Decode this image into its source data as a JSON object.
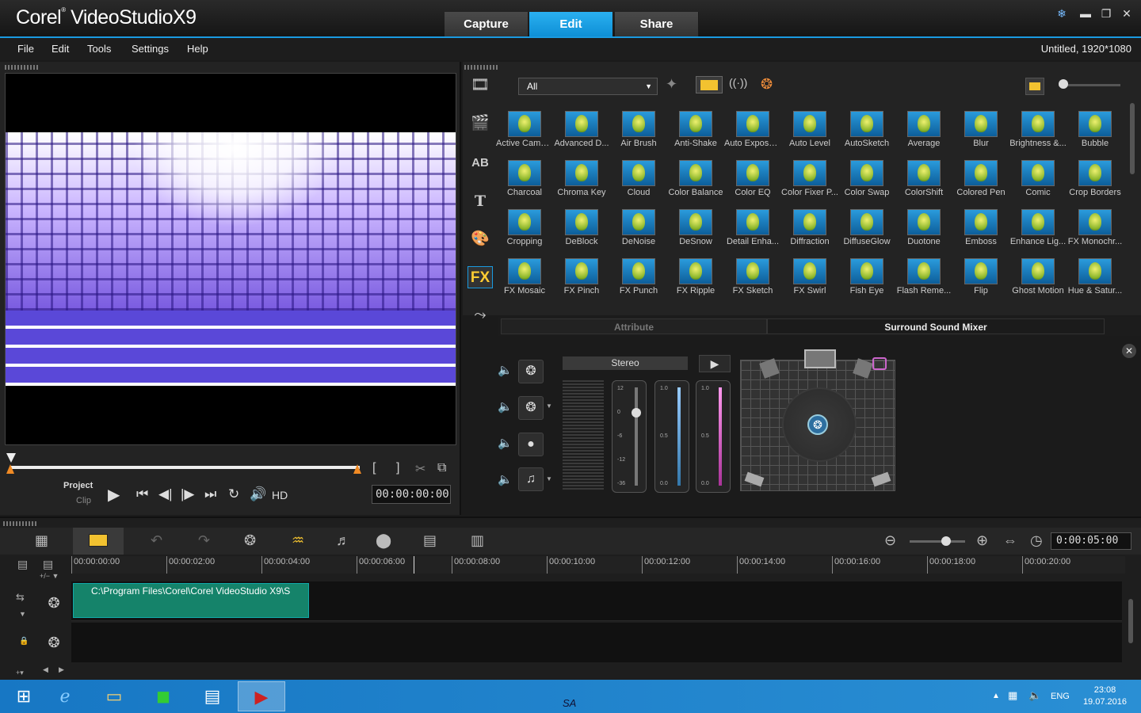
{
  "app": {
    "logo_a": "Corel",
    "logo_b": "VideoStudio",
    "logo_c": "X9"
  },
  "modes": [
    {
      "label": "Capture"
    },
    {
      "label": "Edit"
    },
    {
      "label": "Share"
    }
  ],
  "window": {
    "minimize": "▬",
    "maximize": "❐",
    "close": "✕"
  },
  "menu": [
    "File",
    "Edit",
    "Tools",
    "Settings",
    "Help"
  ],
  "project_info": "Untitled, 1920*1080",
  "player": {
    "project_label": "Project",
    "clip_label": "Clip",
    "hd_label": "HD",
    "timecode": "00:00:00:00",
    "mark_in": "[",
    "mark_out": "]"
  },
  "library": {
    "filter": "All",
    "effects": [
      "Active Camera",
      "Advanced D...",
      "Air Brush",
      "Anti-Shake",
      "Auto Exposure",
      "Auto Level",
      "AutoSketch",
      "Average",
      "Blur",
      "Brightness &...",
      "Bubble",
      "Charcoal",
      "Chroma Key",
      "Cloud",
      "Color Balance",
      "Color EQ",
      "Color Fixer P...",
      "Color Swap",
      "ColorShift",
      "Colored Pen",
      "Comic",
      "Crop Borders",
      "Cropping",
      "DeBlock",
      "DeNoise",
      "DeSnow",
      "Detail Enha...",
      "Diffraction",
      "DiffuseGlow",
      "Duotone",
      "Emboss",
      "Enhance Lig...",
      "FX Monochr...",
      "FX Mosaic",
      "FX Pinch",
      "FX Punch",
      "FX Ripple",
      "FX Sketch",
      "FX Swirl",
      "Fish Eye",
      "Flash Reme...",
      "Flip",
      "Ghost Motion",
      "Hue & Satur..."
    ]
  },
  "panel_tabs": {
    "attribute": "Attribute",
    "surround": "Surround Sound Mixer"
  },
  "mixer": {
    "mode": "Stereo",
    "fader1": [
      "12",
      "0",
      "-6",
      "-12",
      "-36"
    ],
    "fader2": [
      "1.0",
      "0.5",
      "0.0"
    ],
    "fader3": [
      "1.0",
      "0.5",
      "0.0"
    ]
  },
  "timeline": {
    "duration": "0:00:05:00",
    "ticks": [
      "00:00:00:00",
      "00:00:02:00",
      "00:00:04:00",
      "00:00:06:00",
      "00:00:08:00",
      "00:00:10:00",
      "00:00:12:00",
      "00:00:14:00",
      "00:00:16:00",
      "00:00:18:00",
      "00:00:20:00"
    ],
    "clip_path": "C:\\Program Files\\Corel\\Corel VideoStudio X9\\S"
  },
  "taskbar": {
    "lang": "ENG",
    "time": "23:08",
    "date": "19.07.2016",
    "sa": "SA"
  }
}
